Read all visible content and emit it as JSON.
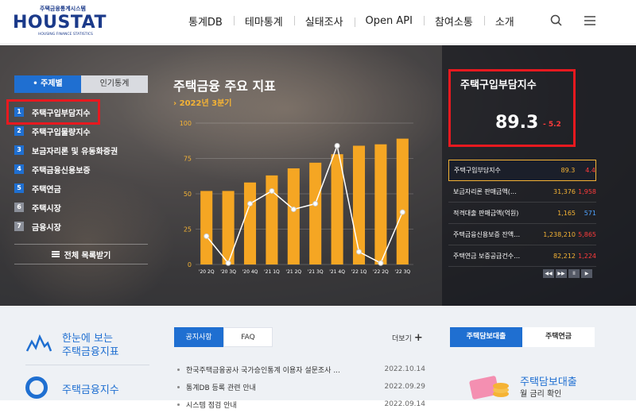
{
  "header": {
    "logo": {
      "sub": "주택금융통계시스템",
      "main": "HOUSTAT",
      "tag": "HOUSING FINANCE STATISTICS"
    },
    "nav": [
      "통계DB",
      "테마통계",
      "실태조사",
      "Open API",
      "참여소통",
      "소개"
    ],
    "icons": {
      "search": "search-icon",
      "menu": "hamburger-menu-icon"
    }
  },
  "hero": {
    "tabs": [
      "• 주제별",
      "인기통계"
    ],
    "active_tab": 0,
    "categories": [
      {
        "num": "1",
        "label": "주택구입부담지수"
      },
      {
        "num": "2",
        "label": "주택구입물량지수"
      },
      {
        "num": "3",
        "label": "보금자리론 및 유동화증권"
      },
      {
        "num": "4",
        "label": "주택금융신용보증"
      },
      {
        "num": "5",
        "label": "주택연금"
      },
      {
        "num": "6",
        "label": "주택시장"
      },
      {
        "num": "7",
        "label": "금융시장"
      }
    ],
    "full_list_label": "전체 목록받기",
    "chart_title": "주택금융 주요 지표",
    "period": "2022년 3분기",
    "big_indicator": {
      "title": "주택구입부담지수",
      "value": "89.3",
      "change": "- 5.2"
    },
    "indicators": [
      {
        "name": "주택구입부담지수",
        "value": "89.3",
        "change": "4.4",
        "dir": "up"
      },
      {
        "name": "보금자리론 판매금액(…",
        "value": "31,376",
        "change": "1,958",
        "dir": "up"
      },
      {
        "name": "적격대출 판매금액(억원)",
        "value": "1,165",
        "change": "571",
        "dir": "down"
      },
      {
        "name": "주택금융신용보증 잔액…",
        "value": "1,238,210",
        "change": "5,865",
        "dir": "up"
      },
      {
        "name": "주택연금 보증공급건수…",
        "value": "82,212",
        "change": "1,224",
        "dir": "up"
      }
    ],
    "pager": [
      "◀◀",
      "▶▶",
      "II",
      "▶"
    ]
  },
  "chart_data": {
    "type": "bar",
    "categories": [
      "'20 2Q",
      "'20 3Q",
      "'20 4Q",
      "'21 1Q",
      "'21 2Q",
      "'21 3Q",
      "'21 4Q",
      "'22 1Q",
      "'22 2Q",
      "'22 3Q"
    ],
    "ylim": [
      0,
      100
    ],
    "yticks": [
      0,
      25,
      50,
      75,
      100
    ],
    "series": [
      {
        "type": "bar",
        "values": [
          52,
          52,
          58,
          63,
          68,
          72,
          78,
          84,
          85,
          89
        ]
      },
      {
        "type": "line",
        "values": [
          20,
          1,
          43,
          52,
          39,
          43,
          84,
          9,
          1,
          37
        ]
      }
    ],
    "colors": {
      "bar": "#f5a623",
      "line": "#ffffff"
    }
  },
  "bottom": {
    "quick1": {
      "line1": "한눈에 보는",
      "line2": "주택금융지표"
    },
    "quick2": "주택금융지수",
    "notice_tabs": [
      "공지사항",
      "FAQ"
    ],
    "more": "더보기",
    "notices": [
      {
        "title": "한국주택금융공사 국가승인통계 이용자 설문조사 ...",
        "date": "2022.10.14"
      },
      {
        "title": "통계DB 등록 관련 안내",
        "date": "2022.09.29"
      },
      {
        "title": "시스템 점검 안내",
        "date": "2022.09.14"
      }
    ],
    "loan_tabs": [
      "주택담보대출",
      "주택연금"
    ],
    "loan_title": "주택담보대출",
    "loan_sub": "월 금리 확인"
  }
}
